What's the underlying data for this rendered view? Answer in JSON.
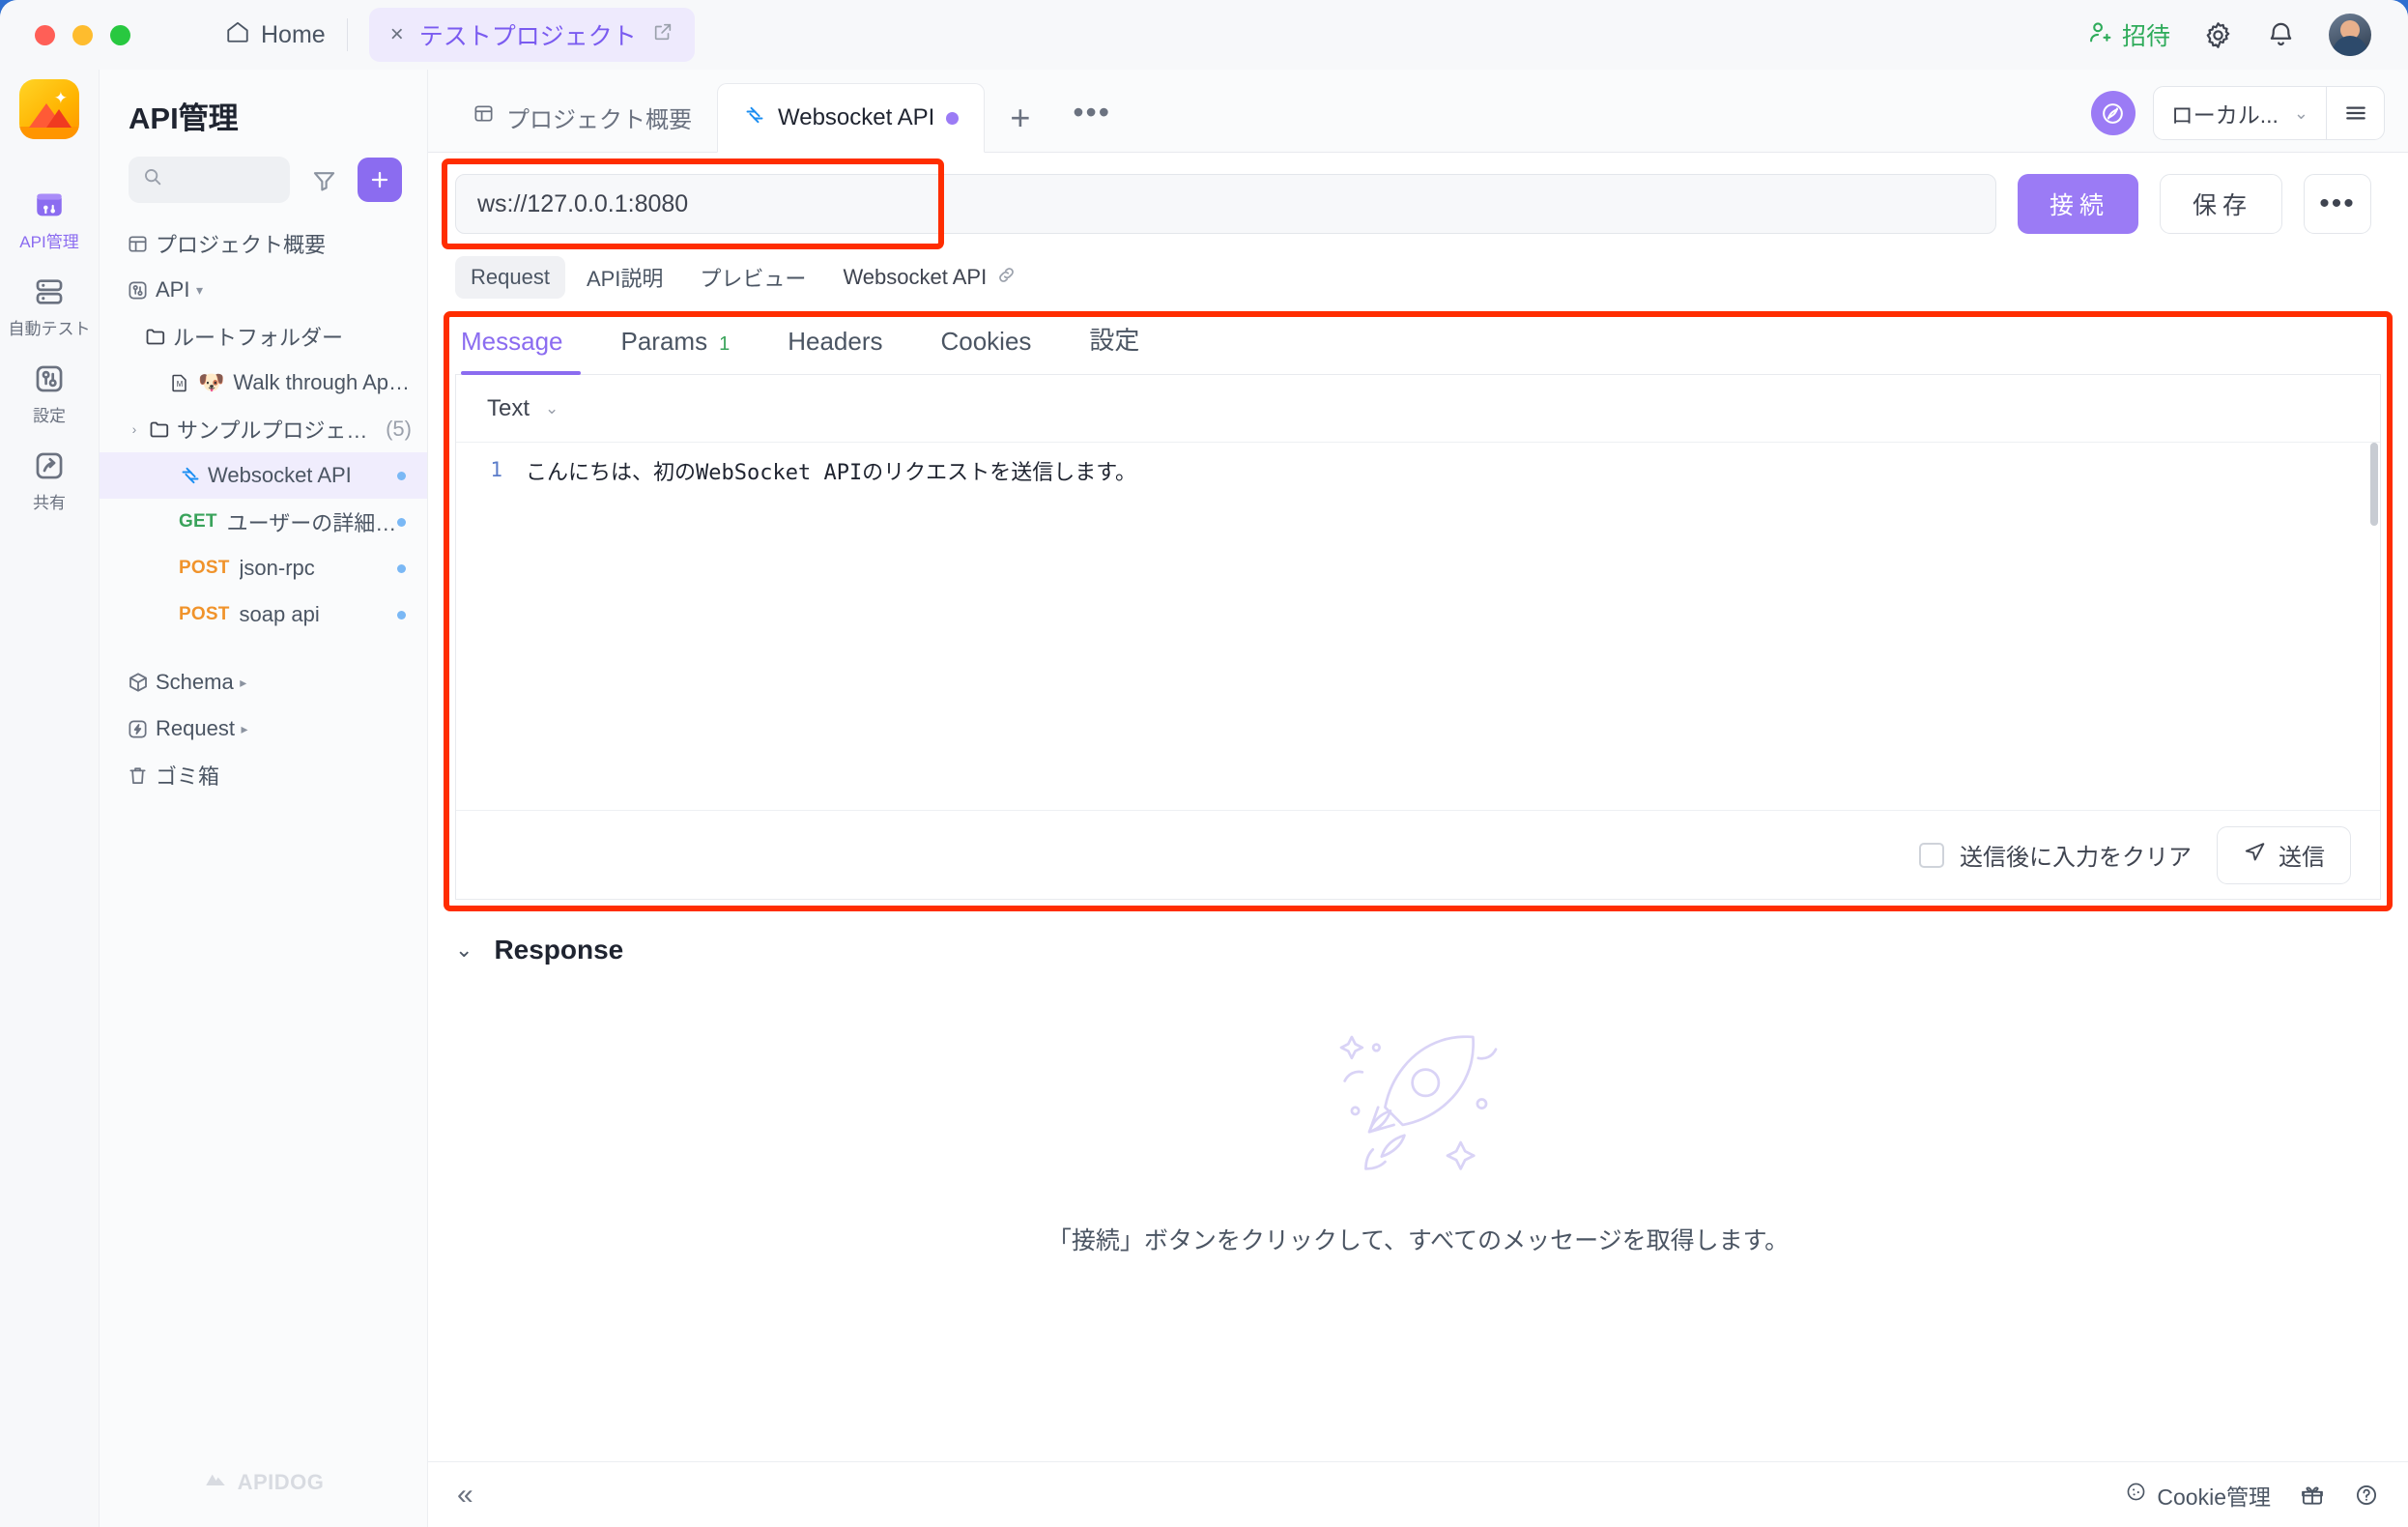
{
  "titlebar": {
    "home_label": "Home",
    "project_tab": "テストプロジェクト",
    "close_glyph": "×",
    "invite_label": "招待"
  },
  "rail": {
    "items": [
      {
        "label": "API管理",
        "icon": "api-manage-icon",
        "active": true
      },
      {
        "label": "自動テスト",
        "icon": "auto-test-icon",
        "active": false
      },
      {
        "label": "設定",
        "icon": "settings-icon",
        "active": false
      },
      {
        "label": "共有",
        "icon": "share-icon",
        "active": false
      }
    ]
  },
  "sidebar": {
    "title": "API管理",
    "search_placeholder": "",
    "add_label": "+",
    "tree": [
      {
        "label": "プロジェクト概要",
        "icon": "overview-icon",
        "level": 0
      },
      {
        "label": "API",
        "icon": "api-icon",
        "level": 0,
        "caret": "▾"
      },
      {
        "label": "ルートフォルダー",
        "icon": "folder-icon",
        "level": 1
      },
      {
        "label": "Walk through Apidog",
        "icon": "markdown-icon",
        "emoji": "🐶",
        "level": 2
      },
      {
        "label": "サンプルプロジェクト",
        "icon": "folder-icon",
        "level": 1,
        "caret": "›",
        "count": "(5)"
      },
      {
        "label": "Websocket API",
        "icon": "websocket-icon",
        "level": 2,
        "selected": true,
        "dot": true
      },
      {
        "label": "ユーザーの詳細情報",
        "method": "GET",
        "level": 2,
        "dot": true
      },
      {
        "label": "json-rpc",
        "method": "POST",
        "level": 2,
        "dot": true
      },
      {
        "label": "soap api",
        "method": "POST",
        "level": 2,
        "dot": true
      },
      {
        "label": "Schema",
        "icon": "schema-icon",
        "level": 0,
        "caret": "▸"
      },
      {
        "label": "Request",
        "icon": "request-icon",
        "level": 0,
        "caret": "▸"
      },
      {
        "label": "ゴミ箱",
        "icon": "trash-icon",
        "level": 0
      }
    ],
    "watermark": "APIDOG"
  },
  "tabstrip": {
    "tabs": [
      {
        "label": "プロジェクト概要",
        "icon": "overview-icon",
        "active": false,
        "dirty": false
      },
      {
        "label": "Websocket API",
        "icon": "websocket-icon",
        "active": true,
        "dirty": true
      }
    ],
    "add_tab": "+",
    "more": "•••",
    "environment": "ローカル...",
    "env_chevron": "⌄"
  },
  "request": {
    "url_value": "ws://127.0.0.1:8080",
    "connect_label": "接続",
    "save_label": "保存",
    "more_label": "•••",
    "mini_tabs": [
      {
        "label": "Request",
        "active": true
      },
      {
        "label": "API説明",
        "active": false
      },
      {
        "label": "プレビュー",
        "active": false
      },
      {
        "label": "Websocket API",
        "active": false,
        "link": true
      }
    ],
    "sub_tabs": [
      {
        "label": "Message",
        "active": true,
        "badge": ""
      },
      {
        "label": "Params",
        "active": false,
        "badge": "1"
      },
      {
        "label": "Headers",
        "active": false,
        "badge": ""
      },
      {
        "label": "Cookies",
        "active": false,
        "badge": ""
      },
      {
        "label": "設定",
        "active": false,
        "badge": ""
      }
    ],
    "format": "Text",
    "format_chevron": "⌄",
    "line_number": "1",
    "message_body": "こんにちは、初のWebSocket APIのリクエストを送信します。",
    "clear_after_send_label": "送信後に入力をクリア",
    "send_label": "送信"
  },
  "response": {
    "title": "Response",
    "chevron": "⌄",
    "empty_text": "「接続」ボタンをクリックして、すべてのメッセージを取得します。"
  },
  "footer": {
    "collapse": "«",
    "cookie_label": "Cookie管理",
    "icons": [
      "gift-icon",
      "help-icon"
    ]
  },
  "colors": {
    "accent": "#8b6cf0",
    "accent_soft": "#9b7bf5",
    "highlight": "#ff2d00",
    "get": "#3aa35b",
    "post": "#f0932b",
    "invite_green": "#2eab5a"
  }
}
